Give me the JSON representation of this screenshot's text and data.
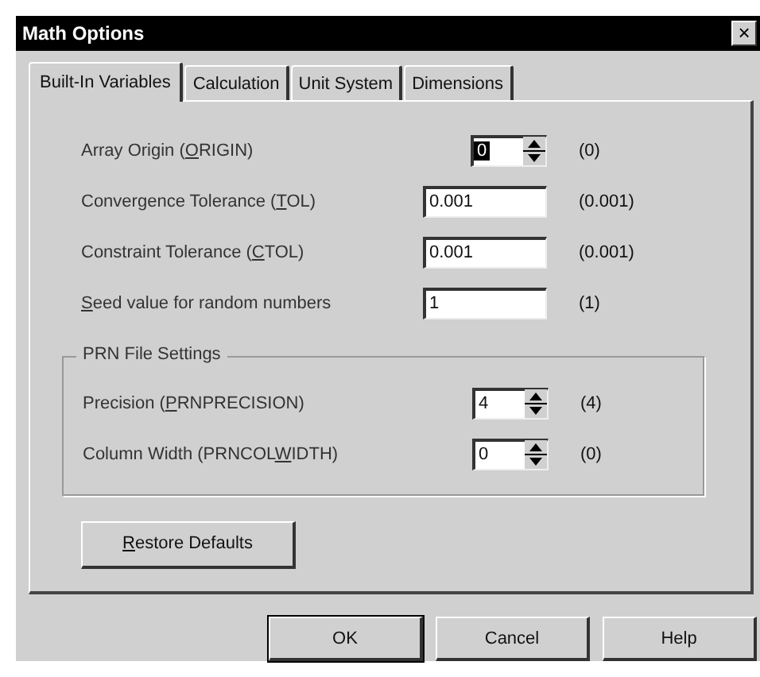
{
  "window": {
    "title": "Math Options",
    "close": "×"
  },
  "tabs": [
    {
      "label": "Built-In Variables",
      "selected": true
    },
    {
      "label": "Calculation",
      "selected": false
    },
    {
      "label": "Unit System",
      "selected": false
    },
    {
      "label": "Dimensions",
      "selected": false
    }
  ],
  "fields": [
    {
      "kind": "spin",
      "before": "Array Origin  (",
      "key": "O",
      "after": "RIGIN)",
      "value": "0",
      "value_selected": true,
      "default": "(0)"
    },
    {
      "kind": "text",
      "before": "Convergence Tolerance  (",
      "key": "T",
      "after": "OL)",
      "value": "0.001",
      "value_selected": false,
      "default": "(0.001)"
    },
    {
      "kind": "text",
      "before": "Constraint Tolerance  (",
      "key": "C",
      "after": "TOL)",
      "value": "0.001",
      "value_selected": false,
      "default": "(0.001)"
    },
    {
      "kind": "text",
      "key": "S",
      "after": "eed value for random numbers",
      "value": "1",
      "value_selected": false,
      "default": "(1)"
    }
  ],
  "prn_group": {
    "title": "PRN File Settings",
    "fields": [
      {
        "kind": "spin",
        "before": "Precision  (",
        "key": "P",
        "after": "RNPRECISION)",
        "value": "4",
        "value_selected": false,
        "default": "(4)"
      },
      {
        "kind": "spin",
        "before": "Column Width  (PRNCOL",
        "key": "W",
        "after": "IDTH)",
        "value": "0",
        "value_selected": false,
        "default": "(0)"
      }
    ]
  },
  "restore_button": {
    "key": "R",
    "after": "estore Defaults"
  },
  "buttons": [
    "OK",
    "Cancel",
    "Help"
  ]
}
